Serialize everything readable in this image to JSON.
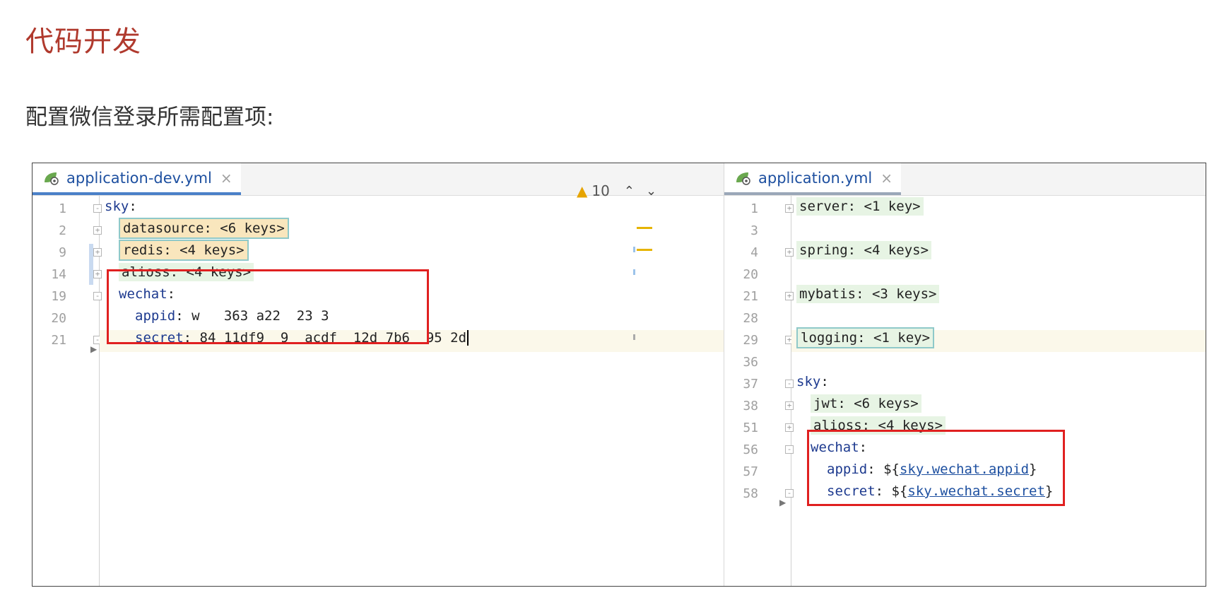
{
  "heading": "代码开发",
  "intro": "配置微信登录所需配置项:",
  "left_pane": {
    "tab_label": "application-dev.yml",
    "close_glyph": "×",
    "warning_count": "10",
    "line_numbers": [
      "1",
      "2",
      "9",
      "14",
      "19",
      "20",
      "21"
    ],
    "lines": {
      "sky_key": "sky",
      "datasource": "datasource: <6 keys>",
      "redis": "redis: <4 keys>",
      "alioss": "alioss: <4 keys>",
      "wechat_key": "wechat",
      "appid_key": "appid",
      "appid_value": "w   363 a22  23 3",
      "secret_key": "secret",
      "secret_value": "84 11df9  9  acdf  12d 7b6  95 2d"
    }
  },
  "right_pane": {
    "tab_label": "application.yml",
    "close_glyph": "×",
    "line_numbers": [
      "1",
      "3",
      "4",
      "20",
      "21",
      "28",
      "29",
      "36",
      "37",
      "38",
      "51",
      "56",
      "57",
      "58"
    ],
    "lines": {
      "server": "server: <1 key>",
      "spring": "spring: <4 keys>",
      "mybatis": "mybatis: <3 keys>",
      "logging": "logging: <1 key>",
      "sky_key": "sky",
      "jwt": "jwt: <6 keys>",
      "alioss": "alioss: <4 keys>",
      "wechat_key": "wechat",
      "appid_key": "appid",
      "appid_ref_prefix": "${",
      "appid_ref": "sky.wechat.appid",
      "appid_ref_suffix": "}",
      "secret_key": "secret",
      "secret_ref_prefix": "${",
      "secret_ref": "sky.wechat.secret",
      "secret_ref_suffix": "}"
    }
  },
  "colors": {
    "heading": "#b03a2e",
    "highlight_box": "#e02020",
    "tab_text": "#1e50a0",
    "key": "#1d3a8f"
  },
  "icons": [
    "spring-leaf-icon",
    "close-icon",
    "warning-icon",
    "chevron-up-icon",
    "chevron-down-icon"
  ]
}
